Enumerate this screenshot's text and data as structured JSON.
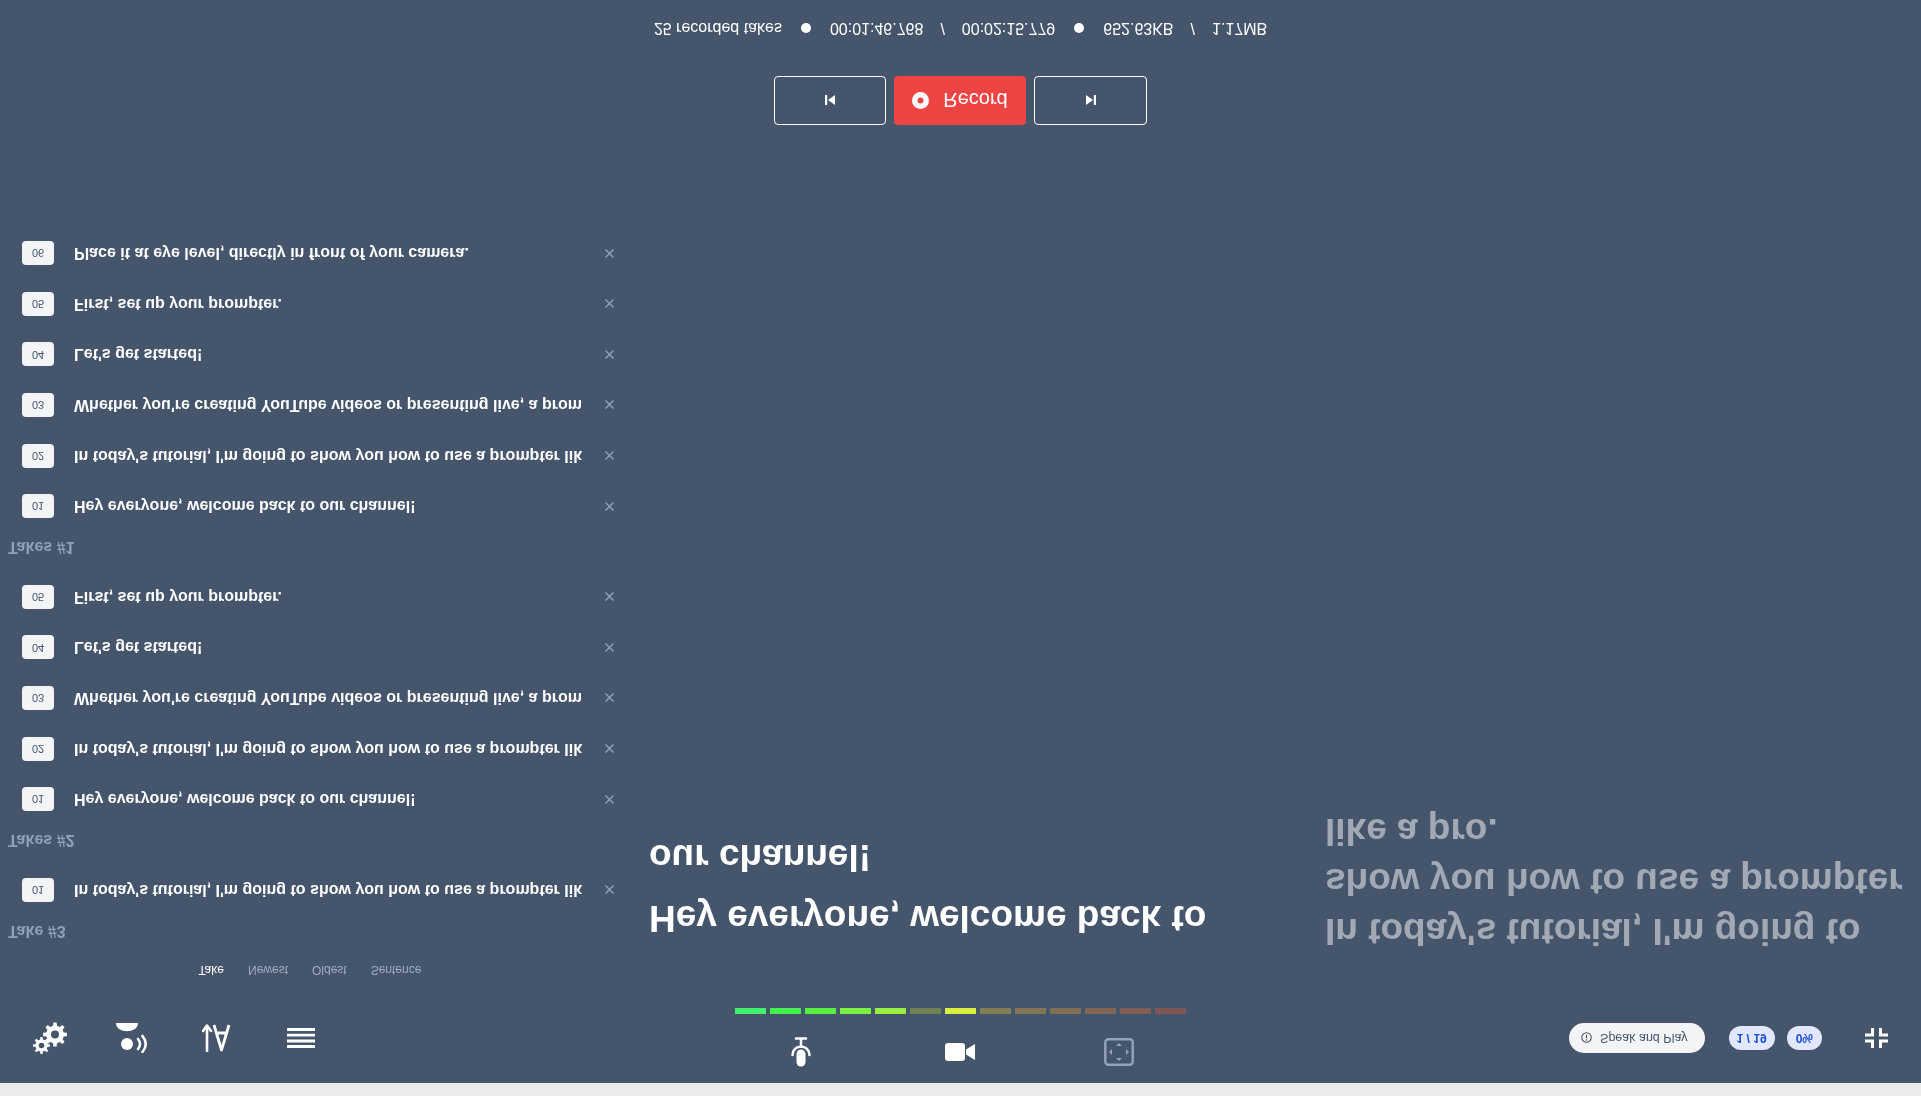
{
  "stats": [
    {
      "kind": "text",
      "text": "25 recorded takes"
    },
    {
      "kind": "dot"
    },
    {
      "kind": "text",
      "text": "00:01:46.768"
    },
    {
      "kind": "separator",
      "text": "/"
    },
    {
      "kind": "text",
      "text": "00:02:15.779"
    },
    {
      "kind": "dot"
    },
    {
      "kind": "text",
      "text": "652.63KB"
    },
    {
      "kind": "separator",
      "text": "/"
    },
    {
      "kind": "text",
      "text": "1.17MB"
    }
  ],
  "transport": {
    "record_label": "Record"
  },
  "take_groups": [
    {
      "title": "Takes #1",
      "takes": [
        {
          "number": "06",
          "text": "Place it at eye level, directly in front of your camera."
        },
        {
          "number": "05",
          "text": "First, set up your prompter."
        },
        {
          "number": "04",
          "text": "Let's get started!"
        },
        {
          "number": "03",
          "text": "Whether you're creating YouTube videos or presenting live, a prom"
        },
        {
          "number": "02",
          "text": "In today's tutorial, I'm going to show you how to use a prompter lik"
        },
        {
          "number": "01",
          "text": "Hey everyone, welcome back to our channel!"
        }
      ]
    },
    {
      "title": "Takes #2",
      "takes": [
        {
          "number": "05",
          "text": "First, set up your prompter."
        },
        {
          "number": "04",
          "text": "Let's get started!"
        },
        {
          "number": "03",
          "text": "Whether you're creating YouTube videos or presenting live, a prom"
        },
        {
          "number": "02",
          "text": "In today's tutorial, I'm going to show you how to use a prompter lik"
        },
        {
          "number": "01",
          "text": "Hey everyone, welcome back to our channel!"
        }
      ]
    },
    {
      "title": "Take #3",
      "takes": [
        {
          "number": "01",
          "text": "In today's tutorial, I'm going to show you how to use a prompter lik"
        }
      ]
    }
  ],
  "prompter": {
    "sentences": [
      {
        "text": "Hey everyone, welcome back to our channel!",
        "current": true
      },
      {
        "text": "In today's tutorial, I'm going to show you how to use a prompter like a pro.",
        "current": false
      }
    ]
  },
  "sort_tabs": [
    {
      "label": "Take",
      "selected": true
    },
    {
      "label": "Newest",
      "selected": false
    },
    {
      "label": "Oldest",
      "selected": false
    },
    {
      "label": "Sentence",
      "selected": false
    }
  ],
  "level_meter": {
    "segments": [
      {
        "on": true
      },
      {
        "on": true
      },
      {
        "on": true
      },
      {
        "on": true
      },
      {
        "on": true
      },
      {
        "on": false
      },
      {
        "on": true
      },
      {
        "on": false
      },
      {
        "on": false
      },
      {
        "on": false
      },
      {
        "on": false
      },
      {
        "on": false
      },
      {
        "on": false
      }
    ]
  },
  "view_controls": [
    {
      "kind": "microphone",
      "active": true
    },
    {
      "kind": "camera",
      "active": true
    },
    {
      "kind": "frame",
      "active": false
    }
  ],
  "status": {
    "mode_button": "Speak and Play",
    "sentence_counter": "1 / 19",
    "progress": "0%"
  }
}
